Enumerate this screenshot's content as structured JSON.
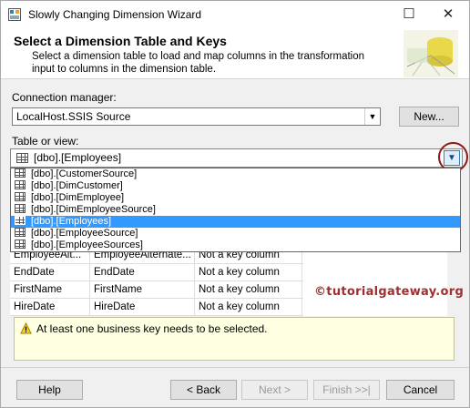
{
  "window": {
    "title": "Slowly Changing Dimension Wizard",
    "maximize_glyph": "☐",
    "close_glyph": "✕"
  },
  "header": {
    "title": "Select a Dimension Table and Keys",
    "description": "Select a dimension table to load and map columns in the transformation input to columns in the dimension table."
  },
  "connection": {
    "label": "Connection manager:",
    "value": "LocalHost.SSIS Source",
    "new_button": "New..."
  },
  "table_view": {
    "label": "Table or view:",
    "value": "[dbo].[Employees]",
    "options": [
      "[dbo].[CustomerSource]",
      "[dbo].[DimCustomer]",
      "[dbo].[DimEmployee]",
      "[dbo].[DimEmployeeSource]",
      "[dbo].[Employees]",
      "[dbo].[EmployeeSource]",
      "[dbo].[EmployeeSources]"
    ],
    "selected_index": 4
  },
  "mapping": {
    "rows": [
      {
        "input": "EmployeeAlt...",
        "dimension": "EmployeeAlternate...",
        "key_type": "Not a key column"
      },
      {
        "input": "EndDate",
        "dimension": "EndDate",
        "key_type": "Not a key column"
      },
      {
        "input": "FirstName",
        "dimension": "FirstName",
        "key_type": "Not a key column"
      },
      {
        "input": "HireDate",
        "dimension": "HireDate",
        "key_type": "Not a key column"
      }
    ]
  },
  "watermark": "©tutorialgateway.org",
  "warning": {
    "message": "At least one business key needs to be selected."
  },
  "buttons": {
    "help": "Help",
    "back": "< Back",
    "next": "Next >",
    "finish": "Finish >>|",
    "cancel": "Cancel"
  },
  "colors": {
    "selection": "#3399ff",
    "warning_bg": "#ffffe1",
    "watermark": "#a03030"
  }
}
